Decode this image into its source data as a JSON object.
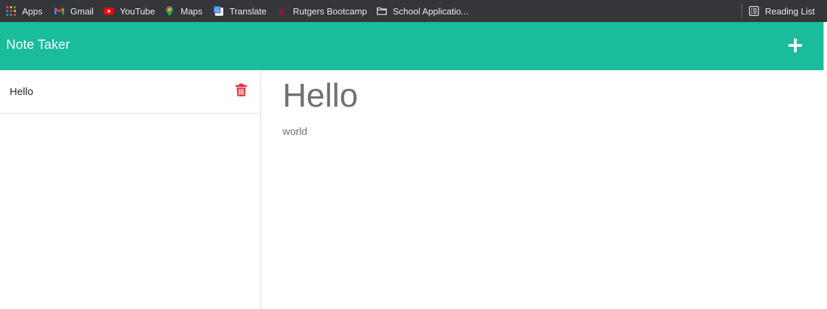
{
  "bookmarks": {
    "apps": "Apps",
    "gmail": "Gmail",
    "youtube": "YouTube",
    "maps": "Maps",
    "translate": "Translate",
    "rutgers": "Rutgers Bootcamp",
    "school": "School Applicatio...",
    "reading_list": "Reading List"
  },
  "navbar": {
    "brand": "Note Taker",
    "add_icon": "plus-icon",
    "color": "#1abc9c"
  },
  "notes": [
    {
      "title": "Hello",
      "delete_icon": "trash-icon"
    }
  ],
  "active_note": {
    "title": "Hello",
    "text": "world"
  },
  "colors": {
    "accent": "#1abc9c",
    "delete": "#dc3545",
    "note_text": "#707070"
  }
}
